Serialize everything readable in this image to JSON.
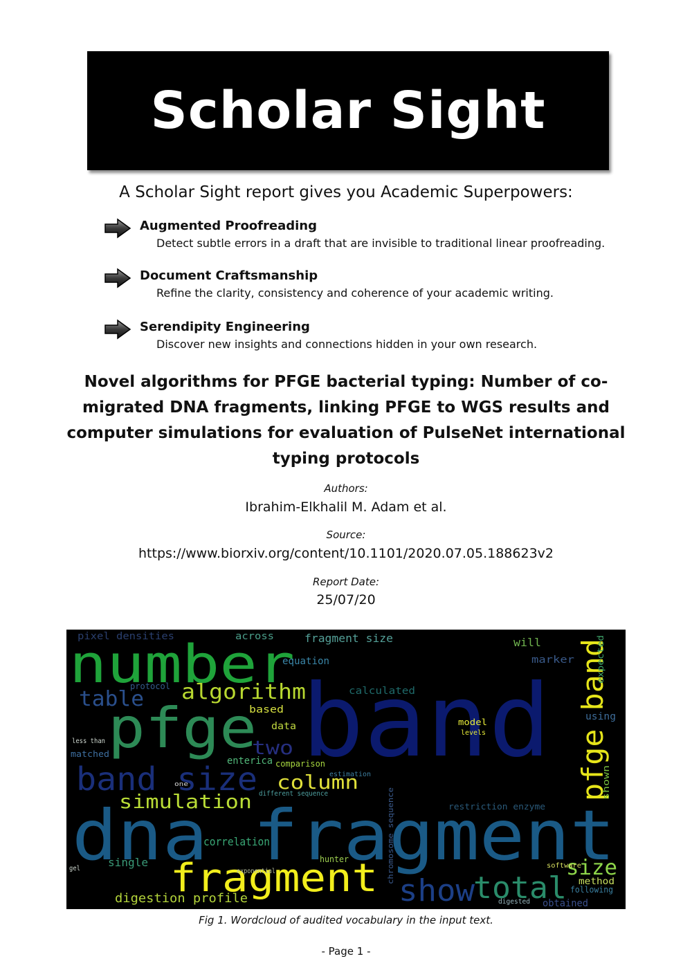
{
  "banner": {
    "title": "Scholar Sight"
  },
  "tagline": "A Scholar Sight report gives you Academic Superpowers:",
  "features": [
    {
      "title": "Augmented Proofreading",
      "desc": "Detect subtle errors in a draft that are invisible to traditional linear proofreading."
    },
    {
      "title": "Document Craftsmanship",
      "desc": "Refine the clarity, consistency and coherence of your academic writing."
    },
    {
      "title": "Serendipity Engineering",
      "desc": "Discover new insights and connections hidden in your own research."
    }
  ],
  "paper": {
    "title": "Novel algorithms for PFGE bacterial typing: Number of co-migrated DNA fragments, linking PFGE to WGS results and computer simulations for evaluation of PulseNet international typing protocols",
    "authors_label": "Authors:",
    "authors": "Ibrahim-Elkhalil M. Adam et al.",
    "source_label": "Source:",
    "source": "https://www.biorxiv.org/content/10.1101/2020.07.05.188623v2",
    "date_label": "Report Date:",
    "date": "25/07/20"
  },
  "wordcloud": {
    "words": [
      {
        "text": "band",
        "color": "#0b1a6e"
      },
      {
        "text": "dna fragment",
        "color": "#1a5a86"
      },
      {
        "text": "number",
        "color": "#1fa33a"
      },
      {
        "text": "pfge",
        "color": "#2d8a56"
      },
      {
        "text": "fragment",
        "color": "#f2ee1c"
      },
      {
        "text": "pfge band",
        "color": "#e6e51a"
      },
      {
        "text": "band size",
        "color": "#1a2f7a"
      },
      {
        "text": "algorithm",
        "color": "#b8d830"
      },
      {
        "text": "simulation",
        "color": "#b9dc36"
      },
      {
        "text": "column",
        "color": "#e0e03a"
      },
      {
        "text": "total",
        "color": "#2a8c6a"
      },
      {
        "text": "size",
        "color": "#8ed64a"
      },
      {
        "text": "show",
        "color": "#1c3f86"
      },
      {
        "text": "table",
        "color": "#2a4f8c"
      },
      {
        "text": "two",
        "color": "#262f80"
      },
      {
        "text": "digestion profile",
        "color": "#b3d43a"
      },
      {
        "text": "correlation",
        "color": "#3aa876"
      },
      {
        "text": "single",
        "color": "#3a9a78"
      },
      {
        "text": "enterica",
        "color": "#52b87a"
      },
      {
        "text": "comparison",
        "color": "#a8d840"
      },
      {
        "text": "data",
        "color": "#c0d840"
      },
      {
        "text": "based",
        "color": "#d6e040"
      },
      {
        "text": "model",
        "color": "#e8ec3a"
      },
      {
        "text": "equation",
        "color": "#3a86a8"
      },
      {
        "text": "fragment size",
        "color": "#54a098"
      },
      {
        "text": "calculated",
        "color": "#1f6a6a"
      },
      {
        "text": "will",
        "color": "#6fb24e"
      },
      {
        "text": "marker",
        "color": "#3a5a8a"
      },
      {
        "text": "across",
        "color": "#4a9e8a"
      },
      {
        "text": "expected",
        "color": "#3ea46a"
      },
      {
        "text": "using",
        "color": "#3e6d9a"
      },
      {
        "text": "shown",
        "color": "#78c040"
      },
      {
        "text": "method",
        "color": "#c8e060"
      },
      {
        "text": "following",
        "color": "#3a7fa0"
      },
      {
        "text": "obtained",
        "color": "#3a4f8c"
      },
      {
        "text": "software",
        "color": "#d8e060"
      },
      {
        "text": "protocol",
        "color": "#355b8c"
      },
      {
        "text": "matched",
        "color": "#3e6fa0"
      },
      {
        "text": "pixel densities",
        "color": "#2a3f6e"
      },
      {
        "text": "restriction enzyme",
        "color": "#2a5a7a"
      },
      {
        "text": "chromosome sequence",
        "color": "#3a5a8c"
      },
      {
        "text": "different sequence",
        "color": "#4ea0a0"
      },
      {
        "text": "estimation",
        "color": "#3e7fa0"
      },
      {
        "text": "hunter",
        "color": "#9ed050"
      },
      {
        "text": "levels",
        "color": "#e8ec3a"
      },
      {
        "text": "less than",
        "color": "#cfd8d0"
      },
      {
        "text": "gel",
        "color": "#cfd8d0"
      },
      {
        "text": "exponential",
        "color": "#b8c0a0"
      },
      {
        "text": "one",
        "color": "#d8d8d8"
      },
      {
        "text": "digested",
        "color": "#9ab8c0"
      }
    ]
  },
  "figure": {
    "caption": "Fig 1. Wordcloud of audited vocabulary in the input text."
  },
  "footer": {
    "page": "-  Page 1  -"
  }
}
